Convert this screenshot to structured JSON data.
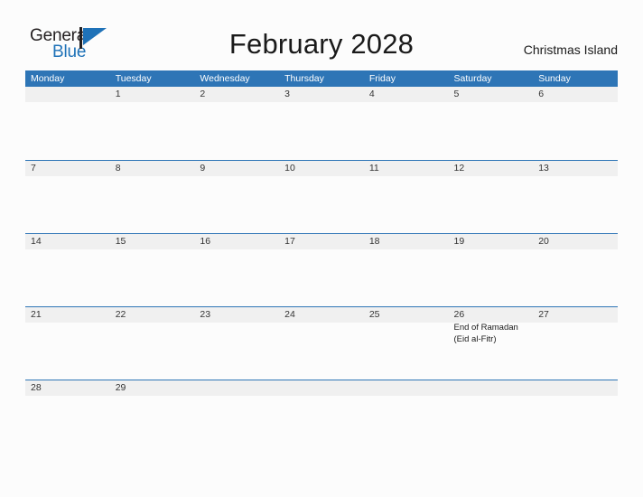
{
  "brand": {
    "name_part1": "General",
    "name_part2": "Blue",
    "logo_icon": "triangle-flag-icon",
    "color_dark": "#231f20",
    "color_blue": "#1f72b8"
  },
  "header": {
    "title": "February 2028",
    "location": "Christmas Island"
  },
  "theme": {
    "header_blue": "#2e75b6",
    "band_gray": "#f0f0f0",
    "page_background": "#fcfcfc",
    "text_color": "#333333"
  },
  "calendar": {
    "weekdays": [
      "Monday",
      "Tuesday",
      "Wednesday",
      "Thursday",
      "Friday",
      "Saturday",
      "Sunday"
    ],
    "weeks": [
      {
        "days": [
          {
            "date": "",
            "events": []
          },
          {
            "date": "1",
            "events": []
          },
          {
            "date": "2",
            "events": []
          },
          {
            "date": "3",
            "events": []
          },
          {
            "date": "4",
            "events": []
          },
          {
            "date": "5",
            "events": []
          },
          {
            "date": "6",
            "events": []
          }
        ]
      },
      {
        "days": [
          {
            "date": "7",
            "events": []
          },
          {
            "date": "8",
            "events": []
          },
          {
            "date": "9",
            "events": []
          },
          {
            "date": "10",
            "events": []
          },
          {
            "date": "11",
            "events": []
          },
          {
            "date": "12",
            "events": []
          },
          {
            "date": "13",
            "events": []
          }
        ]
      },
      {
        "days": [
          {
            "date": "14",
            "events": []
          },
          {
            "date": "15",
            "events": []
          },
          {
            "date": "16",
            "events": []
          },
          {
            "date": "17",
            "events": []
          },
          {
            "date": "18",
            "events": []
          },
          {
            "date": "19",
            "events": []
          },
          {
            "date": "20",
            "events": []
          }
        ]
      },
      {
        "days": [
          {
            "date": "21",
            "events": []
          },
          {
            "date": "22",
            "events": []
          },
          {
            "date": "23",
            "events": []
          },
          {
            "date": "24",
            "events": []
          },
          {
            "date": "25",
            "events": []
          },
          {
            "date": "26",
            "events": [
              "End of Ramadan",
              "(Eid al-Fitr)"
            ]
          },
          {
            "date": "27",
            "events": []
          }
        ]
      },
      {
        "days": [
          {
            "date": "28",
            "events": []
          },
          {
            "date": "29",
            "events": []
          },
          {
            "date": "",
            "events": []
          },
          {
            "date": "",
            "events": []
          },
          {
            "date": "",
            "events": []
          },
          {
            "date": "",
            "events": []
          },
          {
            "date": "",
            "events": []
          }
        ]
      }
    ]
  }
}
